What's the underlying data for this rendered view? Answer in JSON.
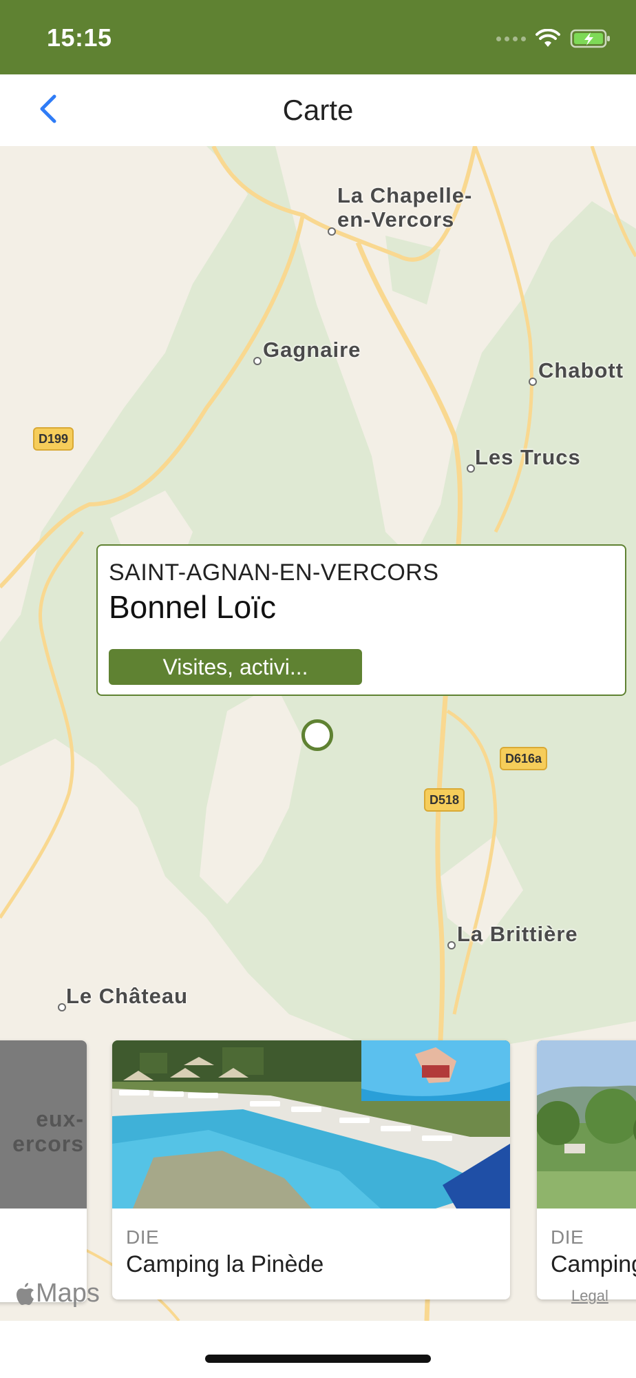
{
  "status_bar": {
    "time": "15:15",
    "wifi_icon": "wifi-icon",
    "battery_icon": "battery-charging-icon"
  },
  "nav": {
    "title": "Carte",
    "back_icon": "chevron-left-icon"
  },
  "map": {
    "places": [
      {
        "id": "la-chapelle",
        "name": "La Chapelle-\nen-Vercors"
      },
      {
        "id": "gagnaire",
        "name": "Gagnaire"
      },
      {
        "id": "chabott",
        "name": "Chabott"
      },
      {
        "id": "les-trucs",
        "name": "Les Trucs"
      },
      {
        "id": "la-brittiere",
        "name": "La Brittière"
      },
      {
        "id": "le-chateau",
        "name": "Le Château"
      }
    ],
    "roads": [
      "D199",
      "D616a",
      "D518"
    ],
    "callout": {
      "town": "SAINT-AGNAN-EN-VERCORS",
      "name": "Bonnel Loïc",
      "category": "Visites, activi..."
    },
    "attribution": {
      "brand": "Maps",
      "legal": "Legal"
    }
  },
  "cards": [
    {
      "image_text": "eux-\nercors"
    },
    {
      "town": "DIE",
      "name": "Camping la Pinède"
    },
    {
      "town": "DIE",
      "name": "Camping"
    }
  ],
  "colors": {
    "brand": "#5f8232",
    "map_green": "#dfe9d3",
    "map_road": "#f9d890",
    "road_badge": "#f6cd5a"
  }
}
